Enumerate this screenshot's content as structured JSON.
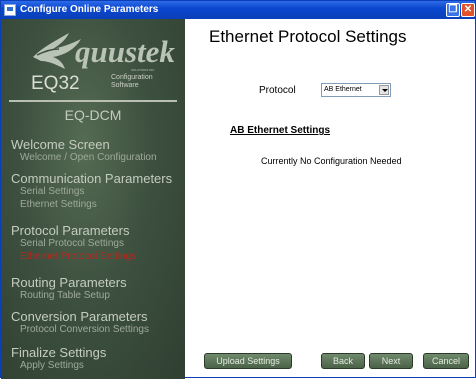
{
  "window": {
    "title": "Configure Online Parameters"
  },
  "brand": {
    "logo_text": "quustek",
    "logo_subtext": "SOLUTIONS INC.",
    "model": "EQ32",
    "model_sub_line1": "Configuration",
    "model_sub_line2": "Software",
    "device": "EQ-DCM"
  },
  "nav": {
    "welcome": {
      "label": "Welcome Screen",
      "items": [
        "Welcome / Open Configuration"
      ]
    },
    "communication": {
      "label": "Communication Parameters",
      "items": [
        "Serial Settings",
        "Ethernet Settings"
      ]
    },
    "protocol": {
      "label": "Protocol Parameters",
      "items": [
        "Serial Protocol Settings",
        "Ethernet Protocol Settings"
      ],
      "active_index": 1
    },
    "routing": {
      "label": "Routing Parameters",
      "items": [
        "Routing Table Setup"
      ]
    },
    "conversion": {
      "label": "Conversion Parameters",
      "items": [
        "Protocol Conversion Settings"
      ]
    },
    "finalize": {
      "label": "Finalize Settings",
      "items": [
        "Apply Settings"
      ]
    }
  },
  "main": {
    "title": "Ethernet Protocol Settings",
    "protocol_label": "Protocol",
    "protocol_value": "AB Ethernet",
    "section_heading": "AB Ethernet Settings",
    "status_text": "Currently No Configuration Needed"
  },
  "buttons": {
    "upload": "Upload Settings",
    "back": "Back",
    "next": "Next",
    "cancel": "Cancel"
  },
  "colors": {
    "titlebar": "#0a3fb8",
    "sidebar": "#3e5140",
    "active_nav": "#b5281e",
    "button": "#5b7458"
  }
}
